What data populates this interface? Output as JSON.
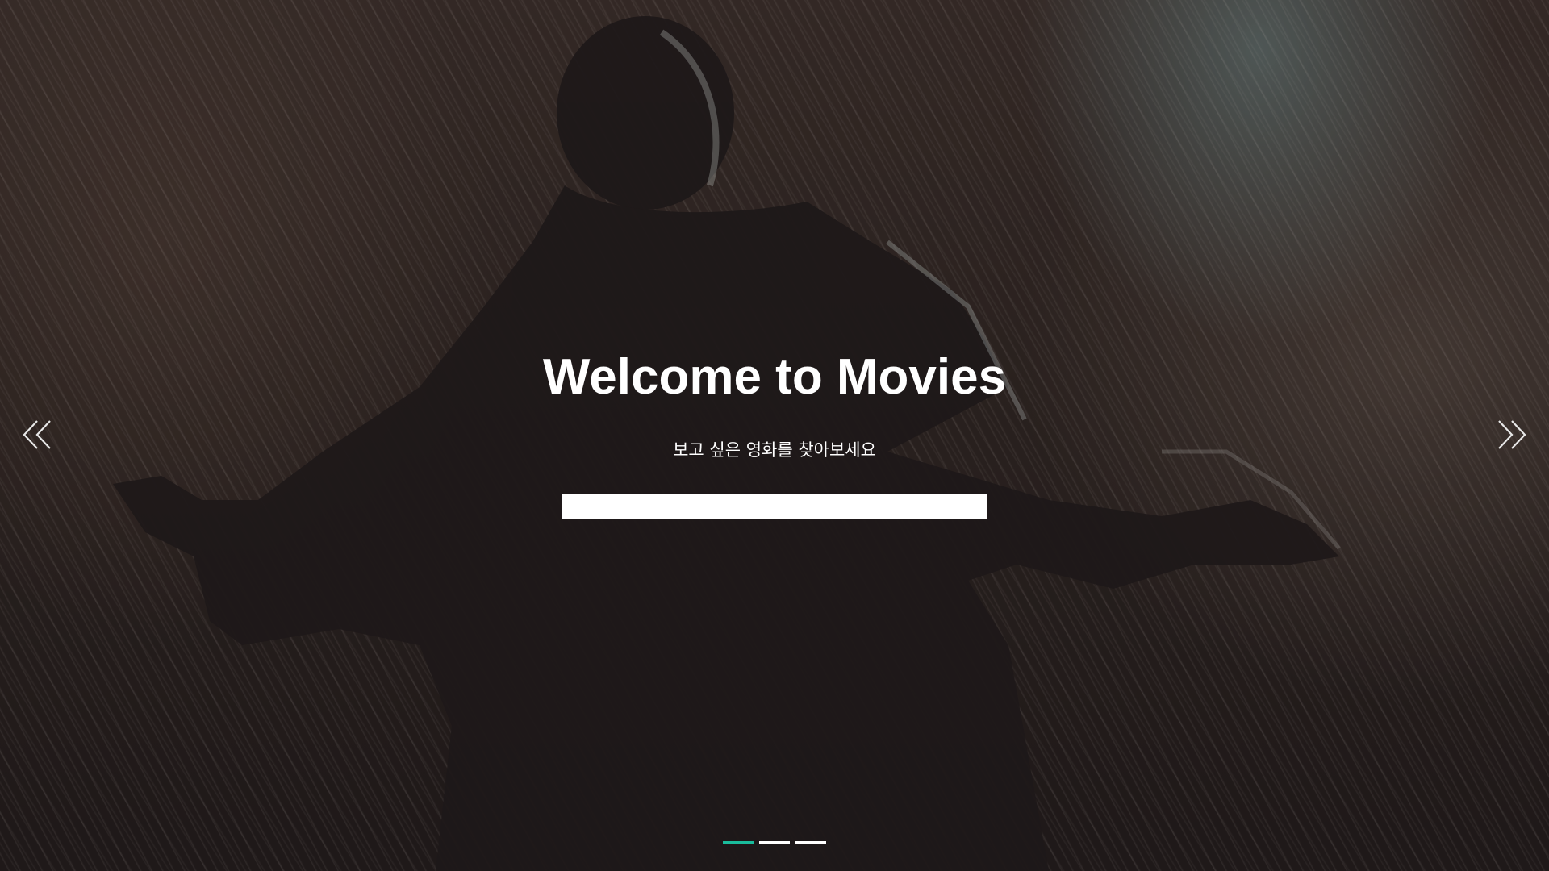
{
  "hero": {
    "title": "Welcome to Movies",
    "subtitle": "보고 싶은 영화를 찾아보세요",
    "background_image": "man-in-rain-arms-outstretched"
  },
  "search": {
    "value": "",
    "placeholder": ""
  },
  "carousel": {
    "prev_icon": "double-chevron-left-icon",
    "next_icon": "double-chevron-right-icon",
    "slides": 3,
    "active_index": 0,
    "active_color": "#1abc9c",
    "inactive_color": "#ffffff"
  }
}
